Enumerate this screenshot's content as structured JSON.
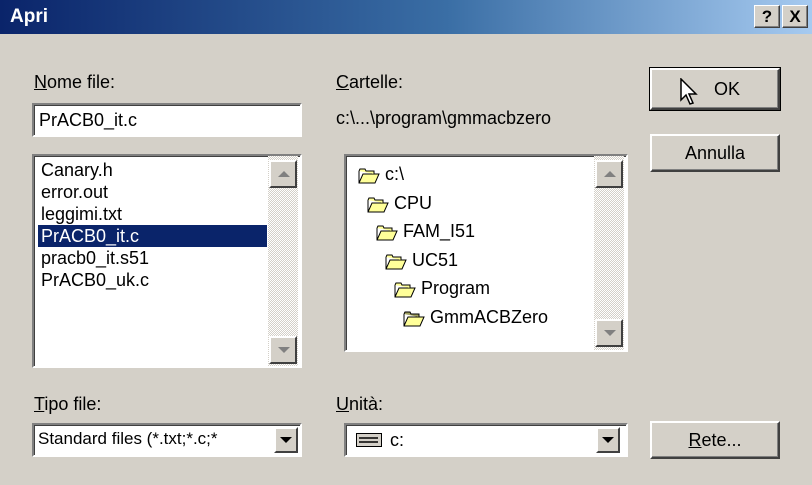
{
  "window": {
    "title": "Apri"
  },
  "title_buttons": {
    "help": "?",
    "close": "X"
  },
  "file_name": {
    "label_ul": "N",
    "label_rest": "ome file:",
    "value": "PrACB0_it.c"
  },
  "files": [
    {
      "name": "Canary.h",
      "selected": false
    },
    {
      "name": "error.out",
      "selected": false
    },
    {
      "name": "leggimi.txt",
      "selected": false
    },
    {
      "name": "PrACB0_it.c",
      "selected": true
    },
    {
      "name": "pracb0_it.s51",
      "selected": false
    },
    {
      "name": "PrACB0_uk.c",
      "selected": false
    }
  ],
  "folders": {
    "label_ul": "C",
    "label_rest": "artelle:",
    "current_path": "c:\\...\\program\\gmmacbzero",
    "tree": [
      {
        "name": "c:\\",
        "open": true
      },
      {
        "name": "CPU",
        "open": true
      },
      {
        "name": "FAM_I51",
        "open": true
      },
      {
        "name": "UC51",
        "open": true
      },
      {
        "name": "Program",
        "open": true
      },
      {
        "name": "GmmACBZero",
        "open": true,
        "current": true
      }
    ]
  },
  "file_type": {
    "label_ul": "T",
    "label_rest": "ipo file:",
    "value": "Standard files (*.txt;*.c;*"
  },
  "drive": {
    "label_ul": "U",
    "label_rest": "nità:",
    "value": "c:",
    "icon": "drive-icon"
  },
  "buttons": {
    "ok": "OK",
    "cancel": "Annulla",
    "network_ul": "R",
    "network_rest": "ete..."
  },
  "colors": {
    "selection": "#0a246a",
    "face": "#d4d0c8",
    "folder": "#ffff99"
  }
}
